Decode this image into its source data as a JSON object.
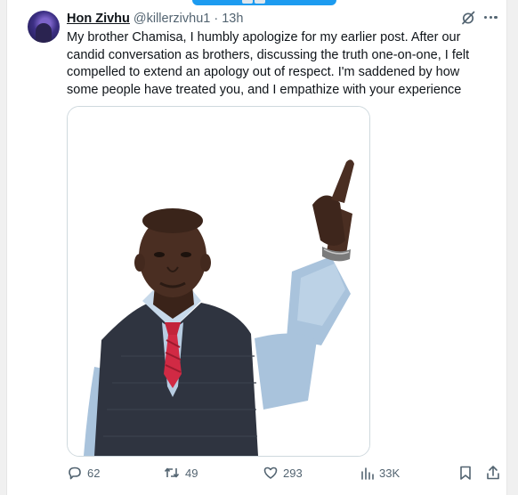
{
  "tweet": {
    "author_name": "Hon Zivhu",
    "handle": "@killerzivhu1",
    "separator": "·",
    "time": "13h",
    "text": "My brother Chamisa, I humbly apologize for my earlier post. After our candid conversation as brothers, discussing the truth one-on-one, I felt compelled to extend an apology out of respect. I'm saddened by how some people have treated you, and I empathize with your experience"
  },
  "actions": {
    "replies": "62",
    "reposts": "49",
    "likes": "293",
    "views": "33K"
  },
  "colors": {
    "accent": "#1d9bf0",
    "text": "#0f1419",
    "muted": "#536471",
    "border": "#cfd9de"
  },
  "icons": [
    "grok-icon",
    "more-icon",
    "reply-icon",
    "repost-icon",
    "like-icon",
    "views-icon",
    "bookmark-icon",
    "share-icon"
  ]
}
